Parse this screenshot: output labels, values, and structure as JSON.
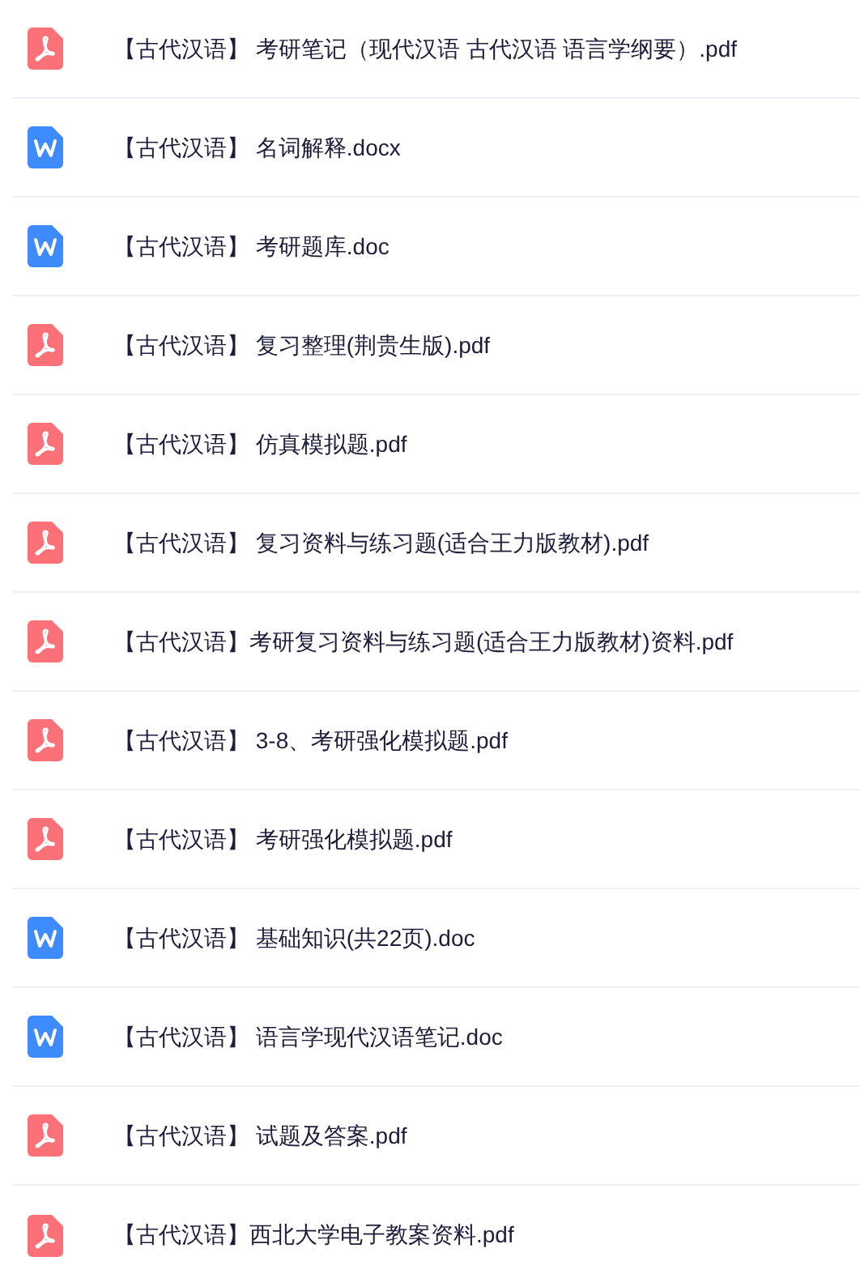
{
  "files": [
    {
      "kind": "pdf",
      "name": "【古代汉语】 考研笔记（现代汉语 古代汉语 语言学纲要）.pdf"
    },
    {
      "kind": "word",
      "name": "【古代汉语】 名词解释.docx"
    },
    {
      "kind": "word",
      "name": "【古代汉语】 考研题库.doc"
    },
    {
      "kind": "pdf",
      "name": "【古代汉语】 复习整理(荆贵生版).pdf"
    },
    {
      "kind": "pdf",
      "name": "【古代汉语】 仿真模拟题.pdf"
    },
    {
      "kind": "pdf",
      "name": "【古代汉语】 复习资料与练习题(适合王力版教材).pdf"
    },
    {
      "kind": "pdf",
      "name": "【古代汉语】考研复习资料与练习题(适合王力版教材)资料.pdf"
    },
    {
      "kind": "pdf",
      "name": "【古代汉语】 3-8、考研强化模拟题.pdf"
    },
    {
      "kind": "pdf",
      "name": "【古代汉语】 考研强化模拟题.pdf"
    },
    {
      "kind": "word",
      "name": "【古代汉语】 基础知识(共22页).doc"
    },
    {
      "kind": "word",
      "name": "【古代汉语】 语言学现代汉语笔记.doc"
    },
    {
      "kind": "pdf",
      "name": "【古代汉语】 试题及答案.pdf"
    },
    {
      "kind": "pdf",
      "name": "【古代汉语】西北大学电子教案资料.pdf"
    }
  ]
}
